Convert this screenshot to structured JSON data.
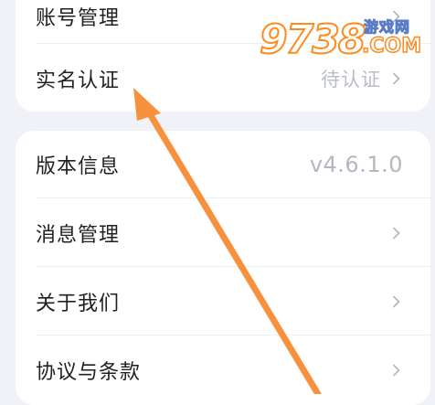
{
  "settings": {
    "account_group": [
      {
        "label": "账号管理",
        "value": "",
        "has_chevron": true
      },
      {
        "label": "实名认证",
        "value": "待认证",
        "has_chevron": true
      }
    ],
    "app_group": [
      {
        "label": "版本信息",
        "value": "v4.6.1.0",
        "has_chevron": false
      },
      {
        "label": "消息管理",
        "value": "",
        "has_chevron": true
      },
      {
        "label": "关于我们",
        "value": "",
        "has_chevron": true
      },
      {
        "label": "协议与条款",
        "value": "",
        "has_chevron": true
      }
    ]
  },
  "watermark": {
    "number": "9738",
    "site_name": "游戏网",
    "domain": ".COM"
  },
  "icons": {
    "chevron": "chevron-right-icon",
    "annotation": "orange-arrow"
  },
  "colors": {
    "background": "#f1f2f7",
    "card": "#ffffff",
    "label_text": "#202124",
    "value_text": "#b9bdc6",
    "annotation_arrow": "#f7913d"
  }
}
